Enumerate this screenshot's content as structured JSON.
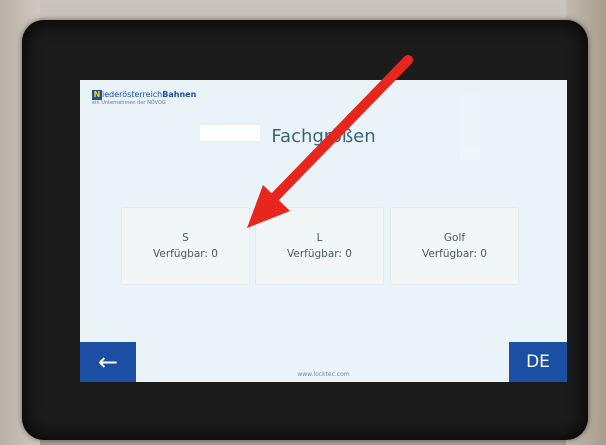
{
  "logo": {
    "mark": "N",
    "name_main": "iederösterreich",
    "name_bold": "Bahnen",
    "subtitle": "ein Unternehmen der NÖVOG"
  },
  "screen": {
    "title": "Fachgrößen"
  },
  "tiles": [
    {
      "size": "S",
      "availability": "Verfügbar: 0"
    },
    {
      "size": "L",
      "availability": "Verfügbar: 0"
    },
    {
      "size": "Golf",
      "availability": "Verfügbar: 0"
    }
  ],
  "nav": {
    "back_icon": "←",
    "language": "DE"
  },
  "footer": {
    "url": "www.locktec.com"
  },
  "colors": {
    "brand_blue": "#1b4fa3",
    "screen_bg": "#eaf3f7",
    "annotation_arrow": "#e8261d"
  }
}
